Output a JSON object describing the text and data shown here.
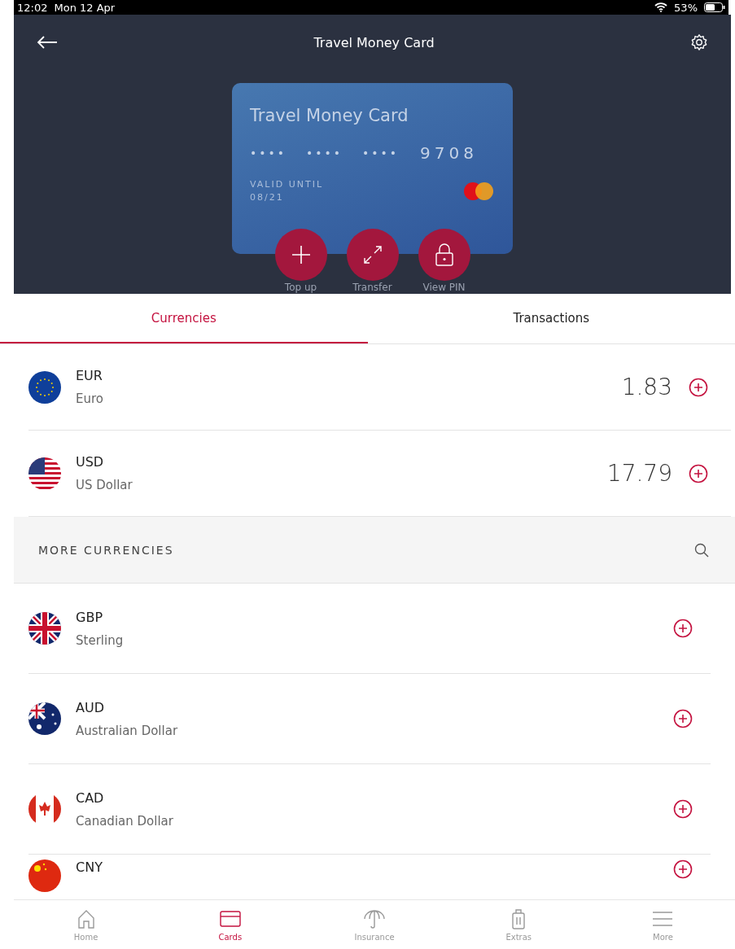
{
  "status_bar": {
    "time": "12:02",
    "date": "Mon 12 Apr",
    "battery": "53%"
  },
  "header": {
    "title": "Travel Money Card"
  },
  "card": {
    "name": "Travel Money Card",
    "masked_groups": [
      "••••",
      "••••",
      "••••"
    ],
    "last_digits": "9708",
    "valid_label": "VALID UNTIL",
    "valid_date": "08/21"
  },
  "actions": [
    {
      "kind": "plus",
      "label": "Top up"
    },
    {
      "kind": "transfer",
      "label": "Transfer"
    },
    {
      "kind": "lock",
      "label": "View PIN"
    }
  ],
  "tabs": [
    {
      "label": "Currencies",
      "selected": true
    },
    {
      "label": "Transactions",
      "selected": false
    }
  ],
  "held_currencies": [
    {
      "kind": "eu",
      "code": "EUR",
      "name": "Euro",
      "amount": "1.83"
    },
    {
      "kind": "us",
      "code": "USD",
      "name": "US Dollar",
      "amount": "17.79"
    }
  ],
  "more_currencies": {
    "title": "MORE CURRENCIES",
    "items": [
      {
        "kind": "gb",
        "code": "GBP",
        "name": "Sterling"
      },
      {
        "kind": "au",
        "code": "AUD",
        "name": "Australian Dollar"
      },
      {
        "kind": "ca",
        "code": "CAD",
        "name": "Canadian Dollar"
      },
      {
        "kind": "cn",
        "code": "CNY"
      }
    ]
  },
  "nav": [
    {
      "kind": "home",
      "label": "Home",
      "selected": false
    },
    {
      "kind": "card",
      "label": "Cards",
      "selected": true
    },
    {
      "kind": "umbrella",
      "label": "Insurance",
      "selected": false
    },
    {
      "kind": "luggage",
      "label": "Extras",
      "selected": false
    },
    {
      "kind": "menu",
      "label": "More",
      "selected": false
    }
  ]
}
